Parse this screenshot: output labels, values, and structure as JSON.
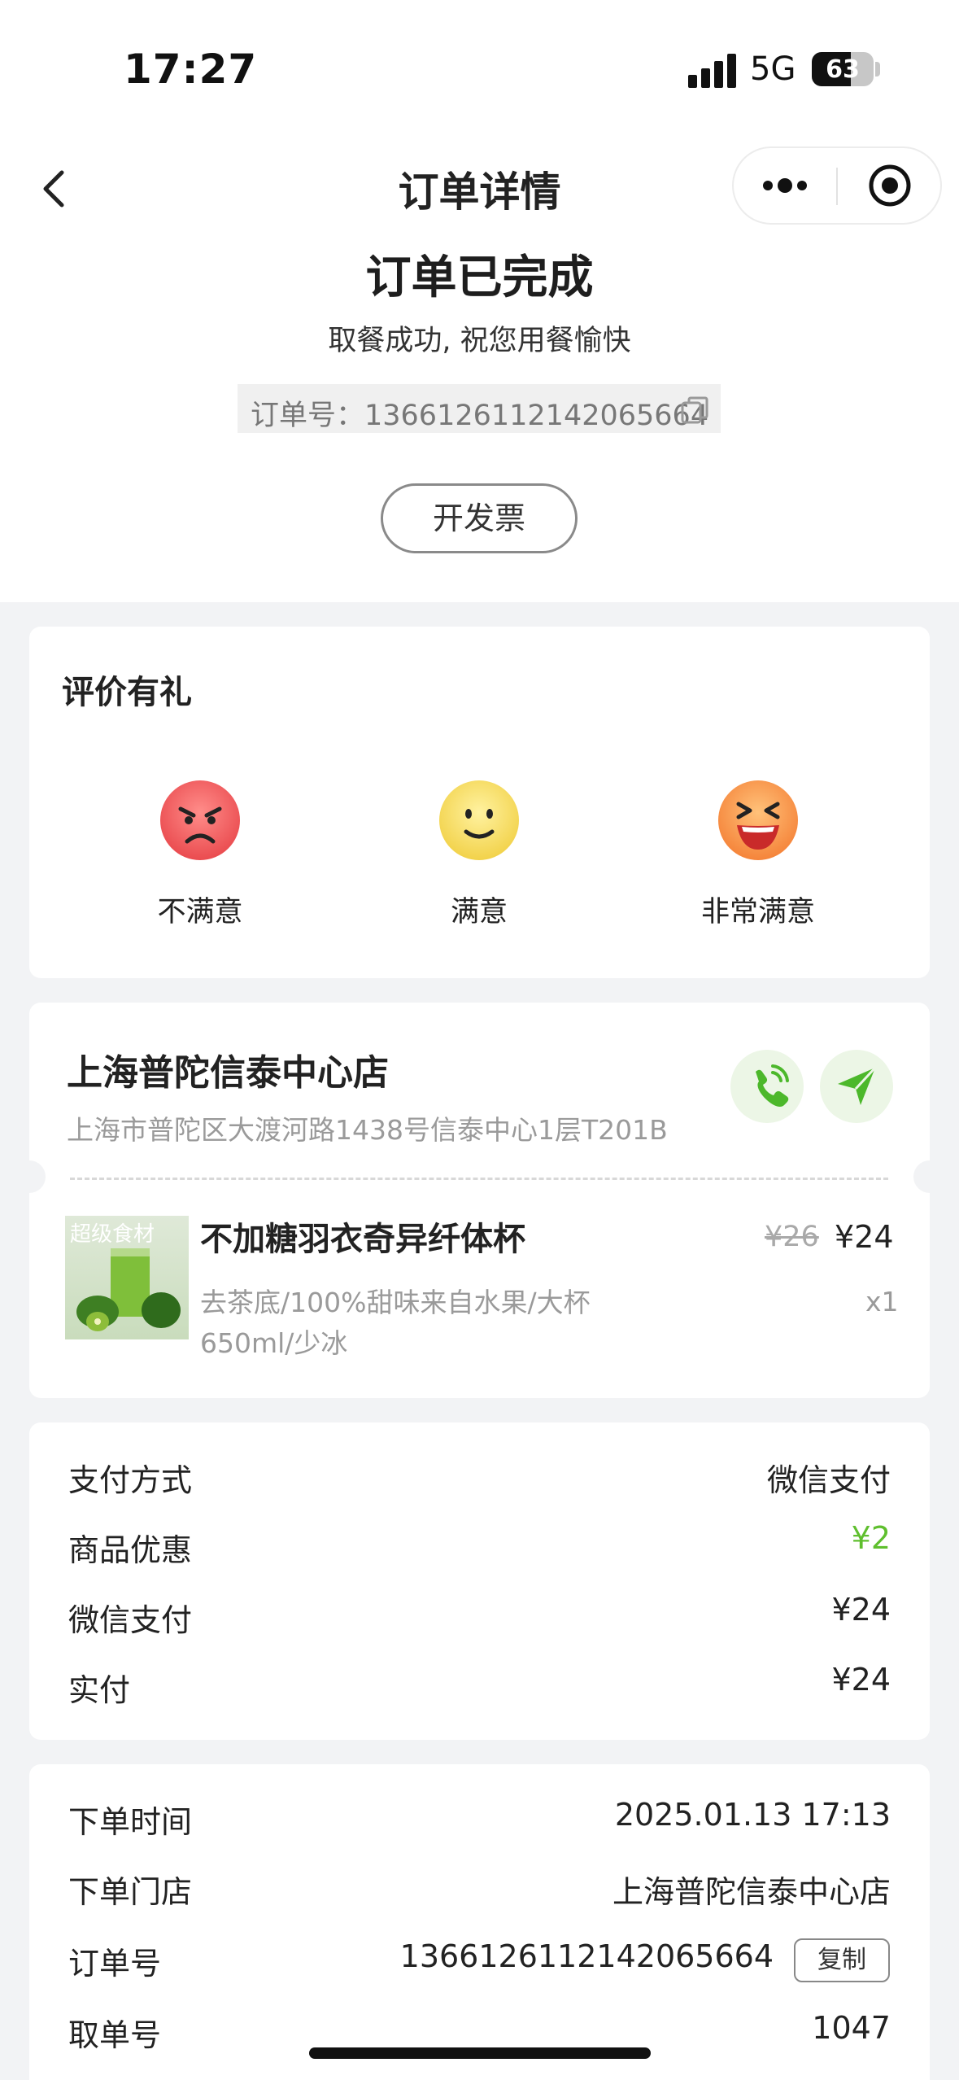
{
  "status_bar": {
    "time": "17:27",
    "network": "5G",
    "battery": "63"
  },
  "nav": {
    "title": "订单详情"
  },
  "order_status": {
    "title": "订单已完成",
    "subtitle": "取餐成功, 祝您用餐愉快",
    "order_no_text": "订单号：1366126112142065664"
  },
  "invoice_button": "开发票",
  "evaluation": {
    "title": "评价有礼",
    "options": [
      {
        "label": "不满意",
        "icon": "angry-face-icon",
        "color": "#f0595b"
      },
      {
        "label": "满意",
        "icon": "smile-face-icon",
        "color": "#f3d54a"
      },
      {
        "label": "非常满意",
        "icon": "laughing-face-icon",
        "color": "#f7913f"
      }
    ]
  },
  "store": {
    "name": "上海普陀信泰中心店",
    "address": "上海市普陀区大渡河路1438号信泰中心1层T201B"
  },
  "product": {
    "image_caption": "超级食材",
    "name": "不加糖羽衣奇异纤体杯",
    "options": "去茶底/100%甜味来自水果/大杯650ml/少冰",
    "original_price": "¥26",
    "price": "¥24",
    "quantity": "x1"
  },
  "payment": [
    {
      "label": "支付方式",
      "value": "微信支付"
    },
    {
      "label": "商品优惠",
      "value": "¥2",
      "accent": "#5fbf2e"
    },
    {
      "label": "微信支付",
      "value": "¥24"
    },
    {
      "label": "实付",
      "value": "¥24"
    }
  ],
  "order_info": [
    {
      "label": "下单时间",
      "value": "2025.01.13 17:13"
    },
    {
      "label": "下单门店",
      "value": "上海普陀信泰中心店"
    },
    {
      "label": "订单号",
      "value": "1366126112142065664"
    },
    {
      "label": "取单号",
      "value": "1047"
    }
  ],
  "copy_button": "复制",
  "colors": {
    "accent_green": "#5fbf2e",
    "background": "#f2f3f5"
  }
}
